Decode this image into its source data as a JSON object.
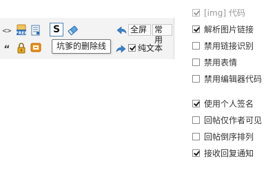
{
  "toolbar": {
    "code_glyph": "<>",
    "strike_letter": "S",
    "quote_glyph": "“",
    "fullscreen_label": "全屏",
    "common_label": "常用",
    "plain_text_label": "纯文本",
    "plain_text_checked": true,
    "tooltip": "坑爹的删除线"
  },
  "options": [
    {
      "label": "[img] 代码",
      "checked": true,
      "disabled": true
    },
    {
      "label": "解析图片链接",
      "checked": true,
      "disabled": false
    },
    {
      "label": "禁用链接识别",
      "checked": false,
      "disabled": false
    },
    {
      "label": "禁用表情",
      "checked": false,
      "disabled": false
    },
    {
      "label": "禁用编辑器代码",
      "checked": false,
      "disabled": false
    },
    {
      "label": "使用个人签名",
      "checked": true,
      "disabled": false
    },
    {
      "label": "回帖仅作者可见",
      "checked": false,
      "disabled": false
    },
    {
      "label": "回帖倒序排列",
      "checked": false,
      "disabled": false
    },
    {
      "label": "接收回复通知",
      "checked": true,
      "disabled": false
    }
  ],
  "colors": {
    "accent_blue": "#2f6fb3",
    "lock_gold": "#d89a1c",
    "hide_orange": "#e28a14"
  }
}
